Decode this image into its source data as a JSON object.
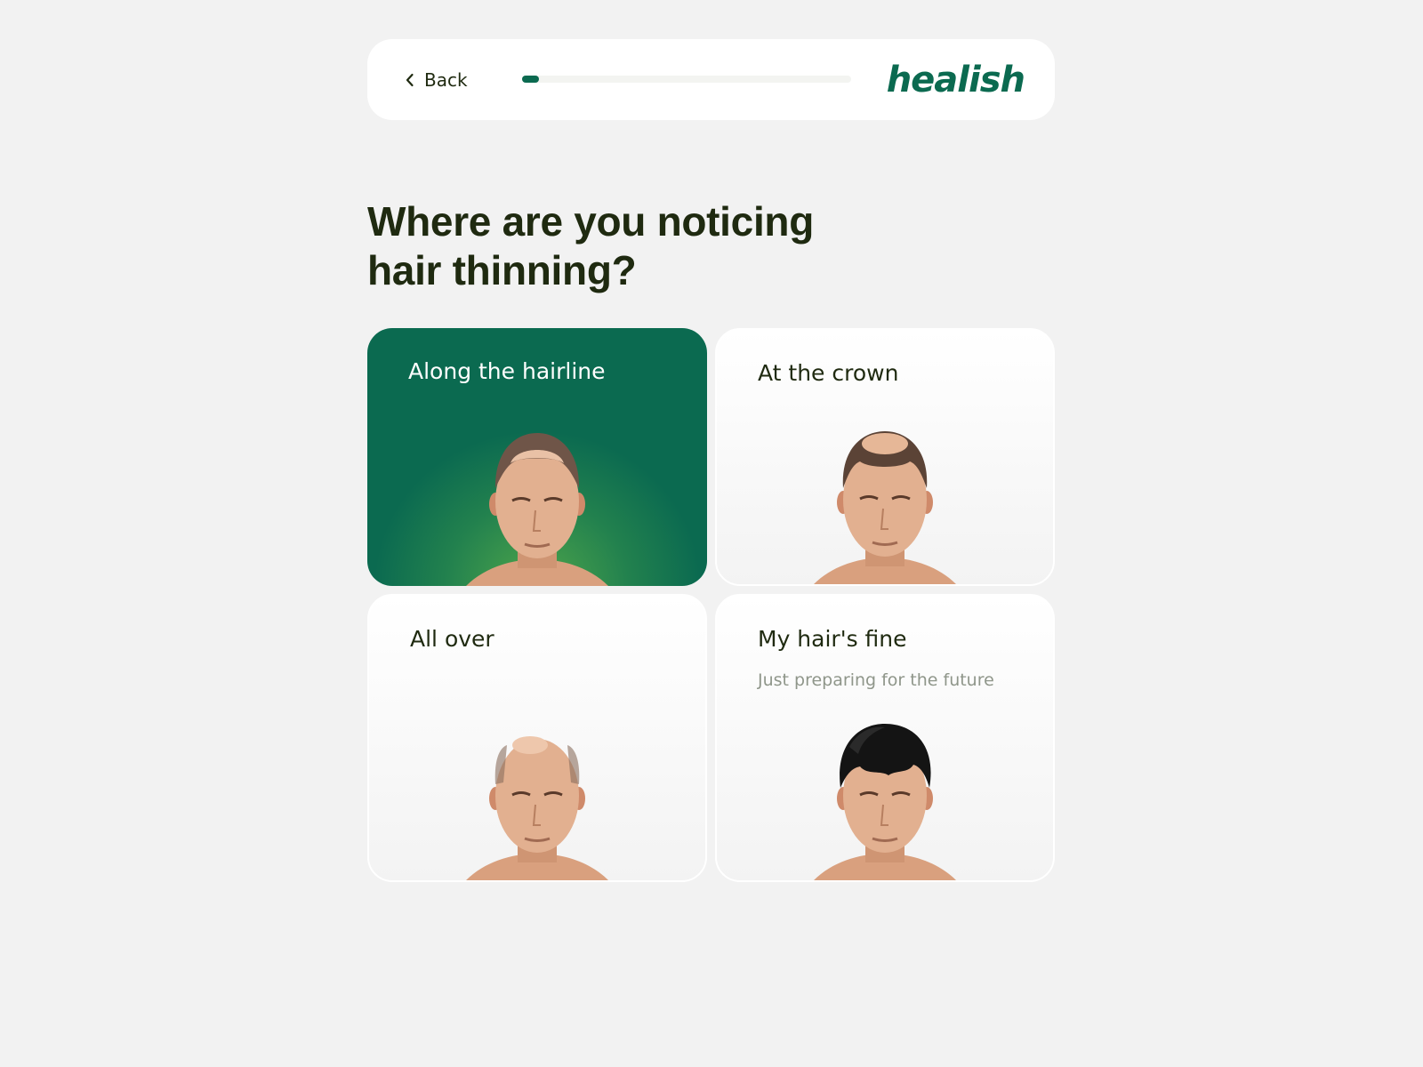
{
  "header": {
    "back_label": "Back",
    "progress": 0.05,
    "logo": "healish"
  },
  "question": {
    "title": "Where are you noticing hair thinning?"
  },
  "options": [
    {
      "label": "Along the hairline",
      "selected": true,
      "image": "man-receding-hairline"
    },
    {
      "label": "At the crown",
      "selected": false,
      "image": "man-thinning-crown"
    },
    {
      "label": "All over",
      "selected": false,
      "image": "man-bald-all-over"
    },
    {
      "label": "My hair's fine",
      "sublabel": "Just preparing for the future",
      "selected": false,
      "image": "man-full-hair"
    }
  ],
  "colors": {
    "accent": "#0b6a50",
    "accent_light": "#4fa64b",
    "text_dark": "#1f2a10",
    "text_muted": "#8f968a",
    "background": "#f2f2f2"
  }
}
